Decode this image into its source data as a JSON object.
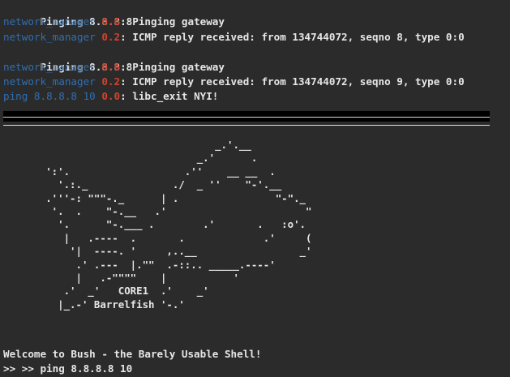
{
  "terminal": {
    "log": [
      {
        "prefix": "",
        "level": "",
        "message": "Pinging 8.8.8.8"
      },
      {
        "prefix": "network_manager",
        "level": "0.6",
        "message": ": Pinging gateway"
      },
      {
        "prefix": "network_manager",
        "level": "0.2",
        "message": ": ICMP reply received: from 134744072, seqno 8, type 0:0"
      },
      {
        "prefix": "",
        "level": "",
        "message": "Pinging 8.8.8.8"
      },
      {
        "prefix": "network_manager",
        "level": "0.6",
        "message": ": Pinging gateway"
      },
      {
        "prefix": "network_manager",
        "level": "0.2",
        "message": ": ICMP reply received: from 134744072, seqno 9, type 0:0"
      },
      {
        "prefix": "ping 8.8.8.8 10",
        "level": "0.0",
        "message": ": libc_exit NYI!"
      }
    ],
    "ascii_art": "                                   _.'.__\n                                _.'      .\n       ':'.                   .''    __ __  .\n         '.:._              ./  _ ''    \"-'.__\n       .'''-: \"\"\"-._      | .                \"-\"._\n        '.  .    \"-.__   .'                       \"\n         '.      \"-.___ .        .'       .   :o'.\n          |   .----  .       .             .'     (\n           '|  ----. '     ,..__                 _'\n            .' .---  |.\"\"  .-::.. _____.----'\n            |   .-\"\"\"\"    |           '\n          .'  _'   CORE1  .'    _'\n         |_.-' Barrelfish '-.'",
    "welcome": "Welcome to Bush - the Barely Usable Shell!",
    "prompt": ">> >> ping 8.8.8.8 10"
  }
}
